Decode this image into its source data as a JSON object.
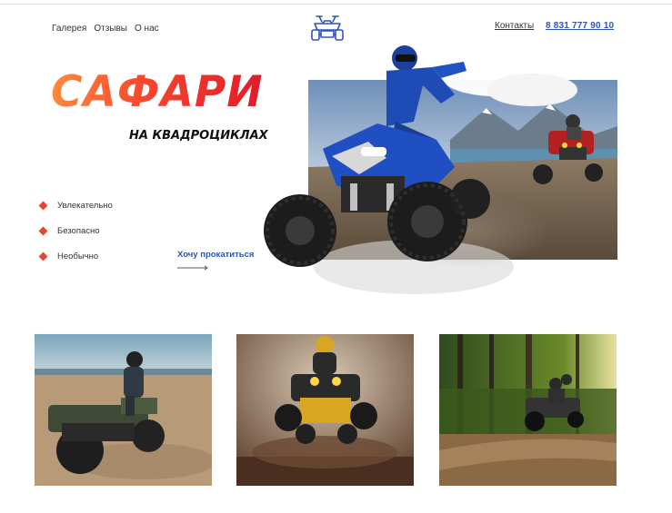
{
  "nav": {
    "items": [
      {
        "label": "Галерея"
      },
      {
        "label": "Отзывы"
      },
      {
        "label": "О нас"
      }
    ]
  },
  "header": {
    "contacts_label": "Контакты",
    "phone": "8 831 777 90 10",
    "logo_icon": "atv-logo-icon"
  },
  "hero": {
    "title": "САФАРИ",
    "subtitle": "НА КВАДРОЦИКЛАХ",
    "features": [
      {
        "label": "Увлекательно"
      },
      {
        "label": "Безопасно"
      },
      {
        "label": "Необычно"
      }
    ],
    "cta_label": "Хочу прокатиться"
  },
  "colors": {
    "accent_blue": "#2d55b8",
    "title_gradient_start": "#ff8a3d",
    "title_gradient_end": "#e01b2a",
    "bullet": "#e8452f"
  }
}
